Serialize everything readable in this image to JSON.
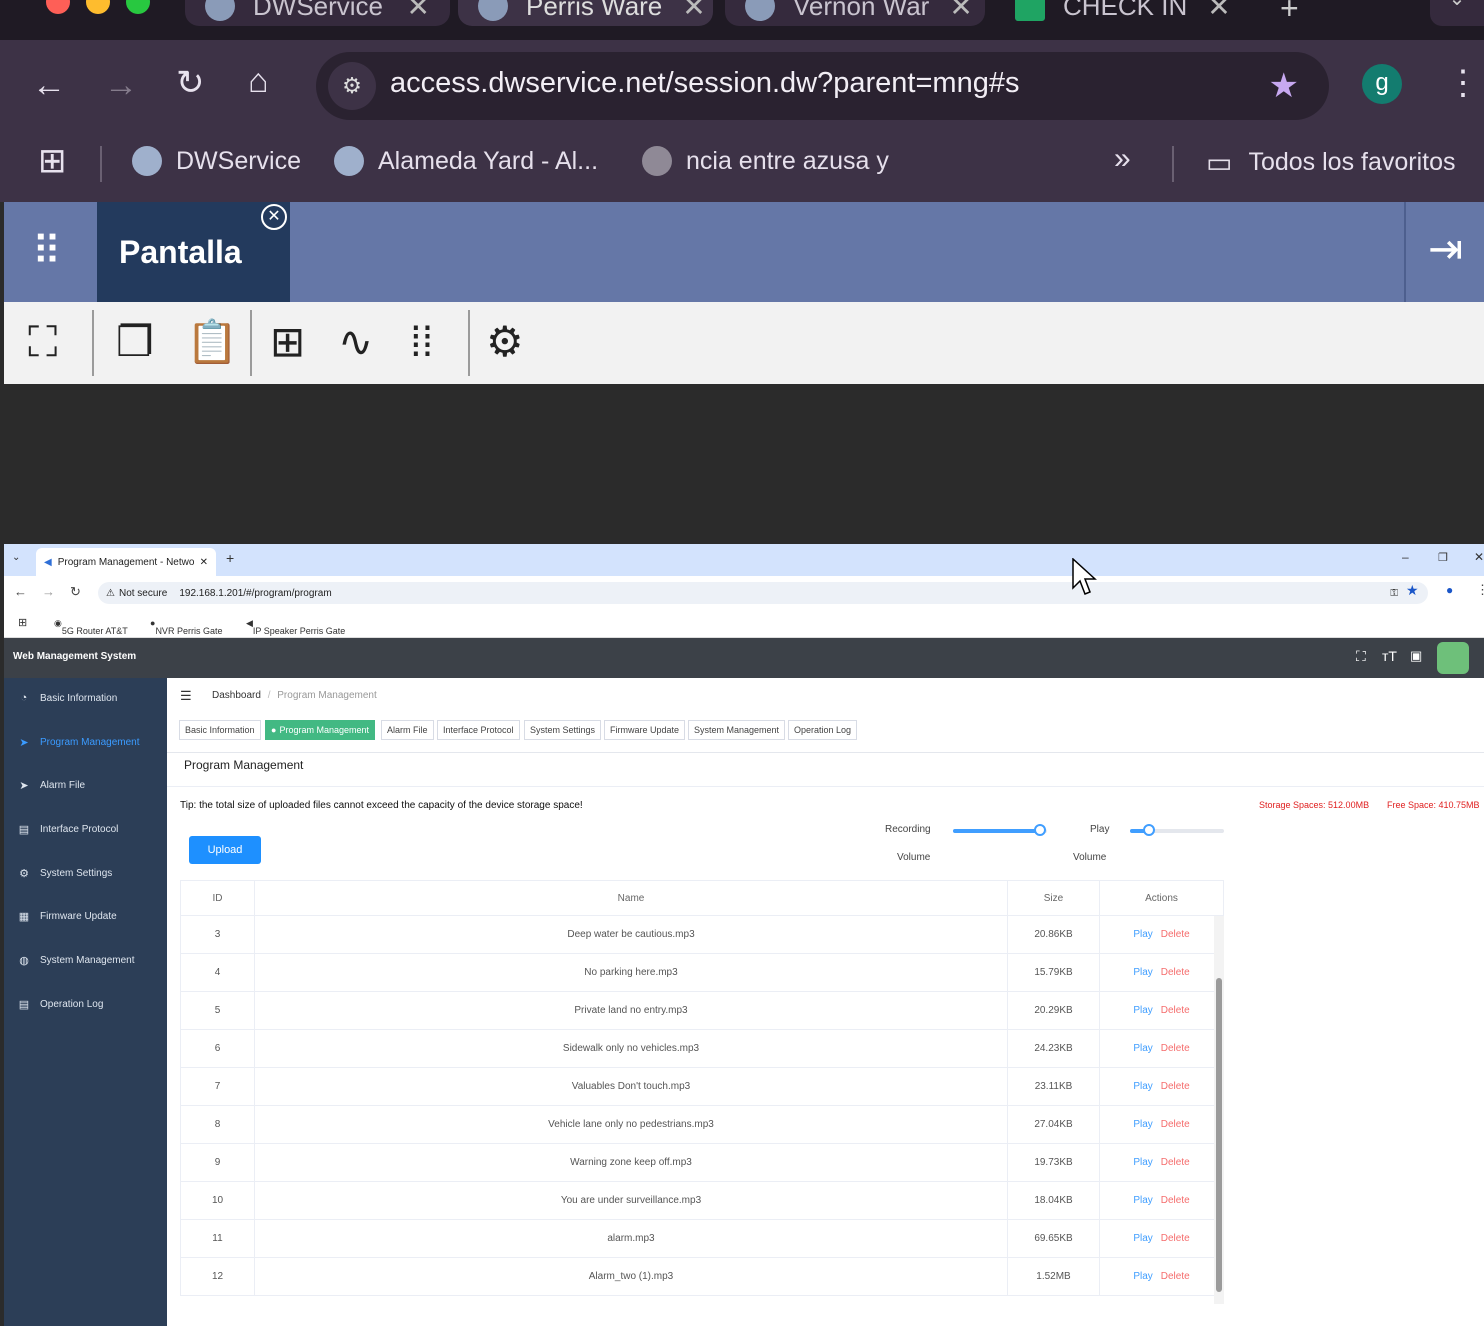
{
  "outer_browser": {
    "tabs": [
      {
        "label": "DWService",
        "active": false
      },
      {
        "label": "Perris Ware",
        "active": true
      },
      {
        "label": "Vernon War",
        "active": false
      },
      {
        "label": "CHECK IN",
        "active": false
      }
    ],
    "address": "access.dwservice.net/session.dw?parent=mng#s",
    "profile_initial": "g",
    "bookmarks": [
      "DWService",
      "Alameda Yard - Al...",
      "ncia entre azusa y"
    ],
    "all_bookmarks_label": "Todos los favoritos"
  },
  "dwservice": {
    "tab_label": "Pantalla"
  },
  "inner_browser": {
    "tab_title": "Program Management - Netwo",
    "security_label": "Not secure",
    "address": "192.168.1.201/#/program/program",
    "bookmarks": [
      "5G Router AT&T",
      "NVR Perris Gate",
      "IP Speaker Perris Gate"
    ]
  },
  "app": {
    "title": "Web Management System",
    "sidebar": [
      {
        "label": "Basic Information",
        "icon": "gauge-icon",
        "active": false
      },
      {
        "label": "Program Management",
        "icon": "send-icon",
        "active": true
      },
      {
        "label": "Alarm File",
        "icon": "send-icon",
        "active": false
      },
      {
        "label": "Interface Protocol",
        "icon": "document-icon",
        "active": false
      },
      {
        "label": "System Settings",
        "icon": "gear-icon",
        "active": false
      },
      {
        "label": "Firmware Update",
        "icon": "grid-icon",
        "active": false
      },
      {
        "label": "System Management",
        "icon": "globe-icon",
        "active": false
      },
      {
        "label": "Operation Log",
        "icon": "log-icon",
        "active": false
      }
    ],
    "breadcrumb": {
      "root": "Dashboard",
      "current": "Program Management"
    },
    "tags": [
      "Basic Information",
      "Program Management",
      "Alarm File",
      "Interface Protocol",
      "System Settings",
      "Firmware Update",
      "System Management",
      "Operation Log"
    ],
    "page_title": "Program Management",
    "tip": "Tip: the total size of uploaded files cannot exceed the capacity of the device storage space!",
    "storage": "Storage Spaces: 512.00MB",
    "free": "Free Space: 410.75MB",
    "upload_label": "Upload",
    "recording_label": "Recording",
    "recording_volume_label": "Volume",
    "recording_level": 0.93,
    "play_label": "Play",
    "play_volume_label": "Volume",
    "play_level": 0.2,
    "table": {
      "headers": [
        "ID",
        "Name",
        "Size",
        "Actions"
      ],
      "play_label": "Play",
      "delete_label": "Delete",
      "rows": [
        {
          "id": "3",
          "name": "Deep water be cautious.mp3",
          "size": "20.86KB"
        },
        {
          "id": "4",
          "name": "No parking here.mp3",
          "size": "15.79KB"
        },
        {
          "id": "5",
          "name": "Private land no entry.mp3",
          "size": "20.29KB"
        },
        {
          "id": "6",
          "name": "Sidewalk only no vehicles.mp3",
          "size": "24.23KB"
        },
        {
          "id": "7",
          "name": "Valuables Don't touch.mp3",
          "size": "23.11KB"
        },
        {
          "id": "8",
          "name": "Vehicle lane only no pedestrians.mp3",
          "size": "27.04KB"
        },
        {
          "id": "9",
          "name": "Warning zone keep off.mp3",
          "size": "19.73KB"
        },
        {
          "id": "10",
          "name": "You are under surveillance.mp3",
          "size": "18.04KB"
        },
        {
          "id": "11",
          "name": "alarm.mp3",
          "size": "69.65KB"
        },
        {
          "id": "12",
          "name": "Alarm_two (1).mp3",
          "size": "1.52MB"
        }
      ]
    }
  }
}
